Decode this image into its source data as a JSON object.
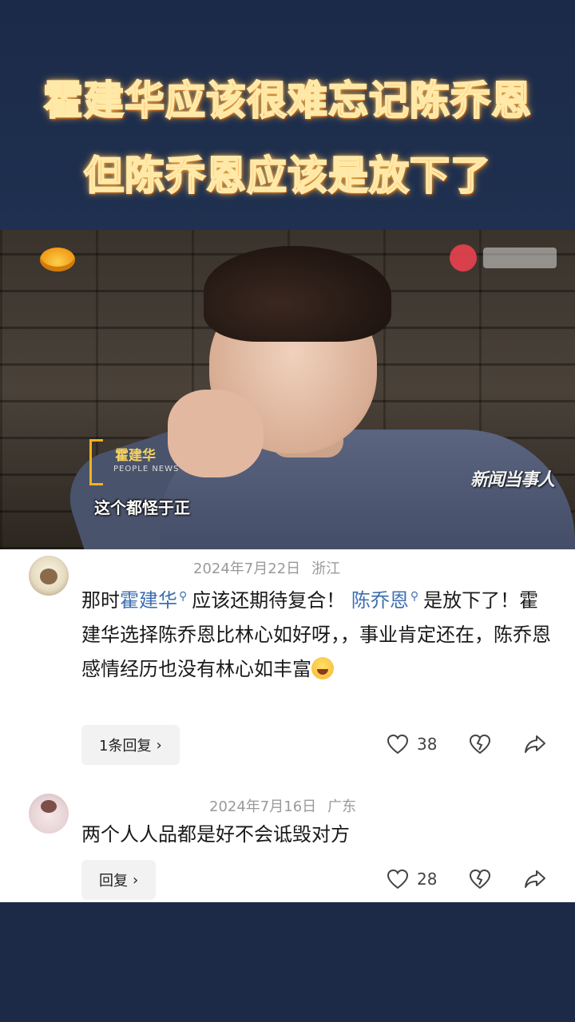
{
  "headline": {
    "line1": "霍建华应该很难忘记陈乔恩",
    "line2": "但陈乔恩应该是放下了"
  },
  "video": {
    "name_plate": "霍建华",
    "name_plate_sub": "PEOPLE NEWS",
    "subtitle": "这个都怪于正",
    "program_logo": "新闻当事人"
  },
  "comments": [
    {
      "date": "2024年7月22日",
      "location": "浙江",
      "text_part1": "那时",
      "mention1": "霍建华",
      "text_part2": "应该还期待复合！",
      "mention2": "陈乔恩",
      "text_part3": "是放下了！霍建华选择陈乔恩比林心如好呀，，事业肯定还在，陈乔恩感情经历也没有林心如丰富",
      "reply_label": "1条回复",
      "likes": "38"
    },
    {
      "date": "2024年7月16日",
      "location": "广东",
      "text": "两个人人品都是好不会诋毁对方",
      "reply_label": "回复",
      "likes": "28"
    }
  ],
  "icons": {
    "mention_icon": "search-icon",
    "like_icon": "heart-icon",
    "dislike_icon": "broken-heart-icon",
    "share_icon": "share-arrow-icon",
    "emoji": "laughing-tears-emoji"
  },
  "colors": {
    "background": "#1c2a47",
    "headline": "#ff7a1a",
    "mention": "#3e6fb0"
  }
}
